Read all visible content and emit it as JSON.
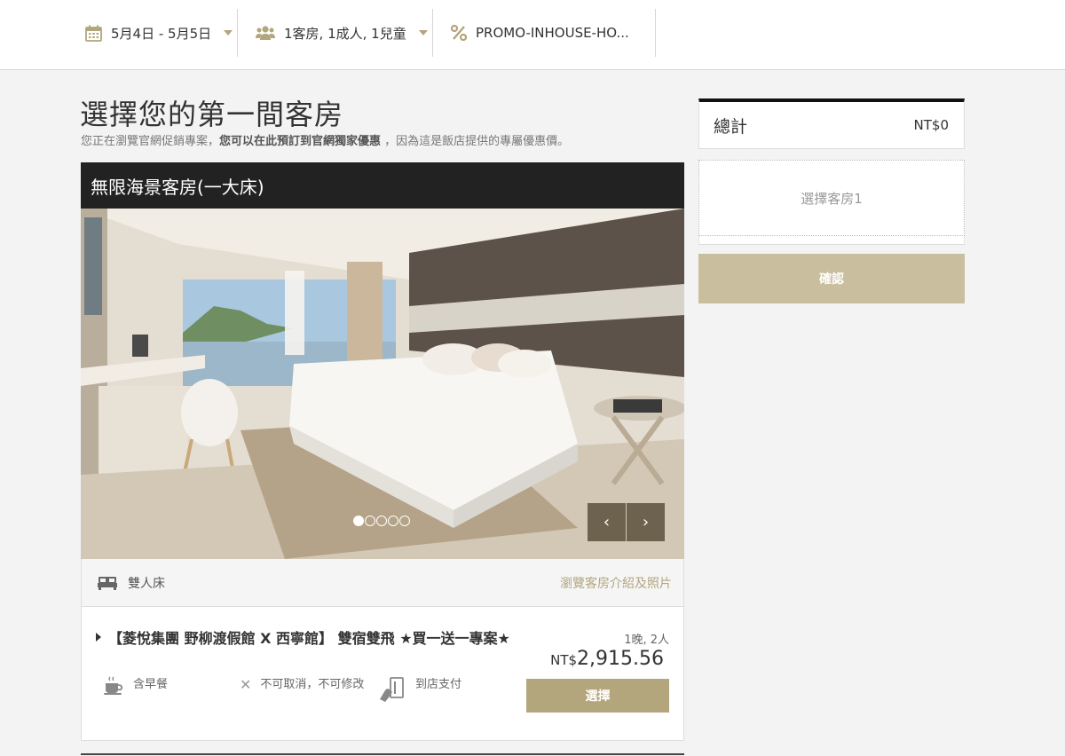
{
  "search_bar": {
    "dates": "5月4日 - 5月5日",
    "guests": "1客房, 1成人, 1兒童",
    "promo": "PROMO-INHOUSE-HO..."
  },
  "page": {
    "title": "選擇您的第一間客房",
    "subtitle_prefix": "您正在瀏覽官網促銷專案，",
    "subtitle_bold": "您可以在此預訂到官網獨家優惠",
    "subtitle_suffix": " ，因為這是飯店提供的專屬優惠價。"
  },
  "room": {
    "name": "無限海景客房(一大床)",
    "bed_type": "雙人床",
    "gallery_link": "瀏覽客房介紹及照片",
    "carousel": {
      "total": 5,
      "active": 1,
      "prev": "‹",
      "next": "›"
    }
  },
  "rate": {
    "title": "【菱悅集團 野柳渡假館 X 西寧館】 雙宿雙飛 ★買一送一專案★",
    "stay_info": "1晚, 2人",
    "currency": "NT$",
    "price": "2,915.56",
    "features": {
      "breakfast": "含早餐",
      "cancellation": "不可取消，不可修改",
      "payment": "到店支付"
    },
    "select_label": "選擇"
  },
  "summary": {
    "total_label": "總計",
    "total_value": "NT$0",
    "room_slot": "選擇客房1",
    "confirm_label": "確認"
  },
  "colors": {
    "accent": "#b3a57c",
    "confirm_disabled": "#c9bf9e",
    "header_dark": "#222222"
  }
}
